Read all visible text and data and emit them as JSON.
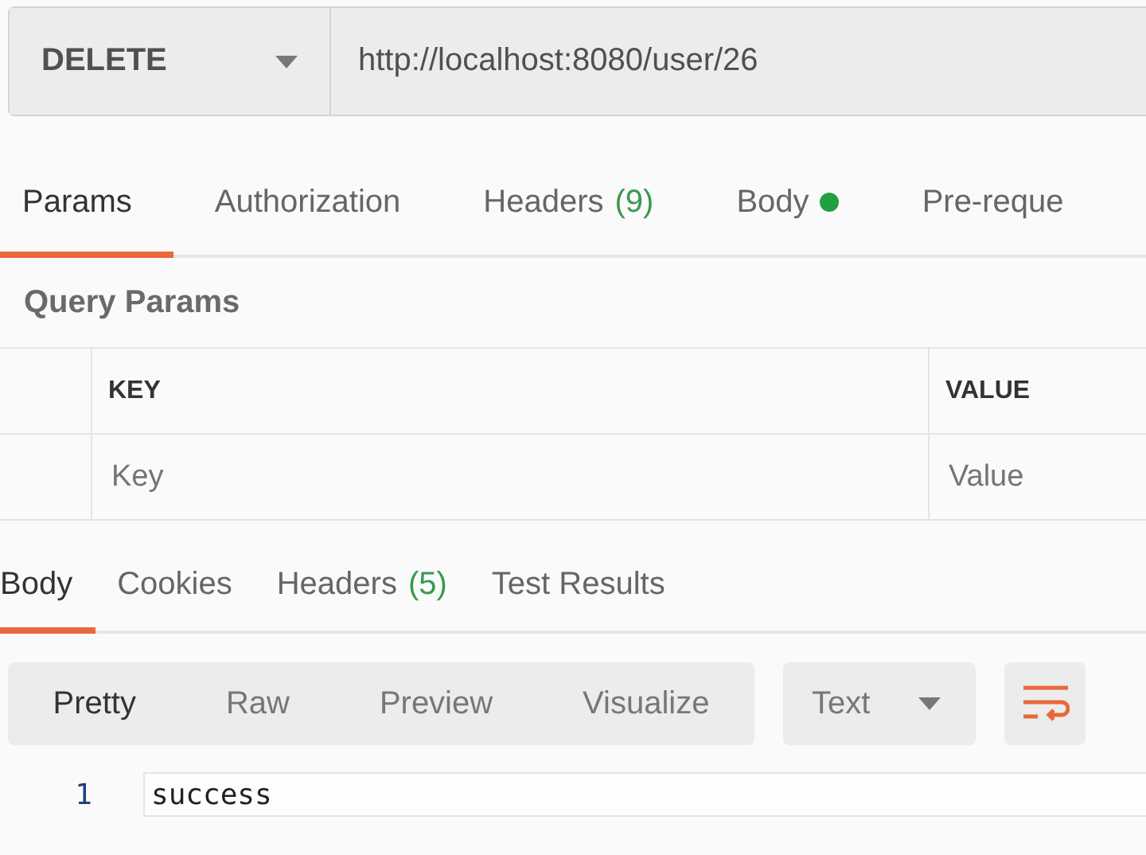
{
  "request": {
    "method": "DELETE",
    "url": "http://localhost:8080/user/26"
  },
  "request_tabs": [
    {
      "label": "Params",
      "selected": true
    },
    {
      "label": "Authorization",
      "selected": false
    },
    {
      "label": "Headers",
      "count": "(9)",
      "selected": false
    },
    {
      "label": "Body",
      "dot": true,
      "selected": false
    },
    {
      "label": "Pre-reque",
      "selected": false
    }
  ],
  "query_params": {
    "title": "Query Params",
    "columns": [
      "KEY",
      "VALUE"
    ],
    "placeholders": [
      "Key",
      "Value"
    ]
  },
  "response_tabs": [
    {
      "label": "Body",
      "selected": true
    },
    {
      "label": "Cookies",
      "selected": false
    },
    {
      "label": "Headers",
      "count": "(5)",
      "selected": false
    },
    {
      "label": "Test Results",
      "selected": false
    }
  ],
  "view_modes": [
    {
      "label": "Pretty",
      "selected": true
    },
    {
      "label": "Raw",
      "selected": false
    },
    {
      "label": "Preview",
      "selected": false
    },
    {
      "label": "Visualize",
      "selected": false
    }
  ],
  "format": {
    "value": "Text"
  },
  "wrap_lines": true,
  "body_lines": [
    {
      "number": "1",
      "text": "success"
    }
  ]
}
